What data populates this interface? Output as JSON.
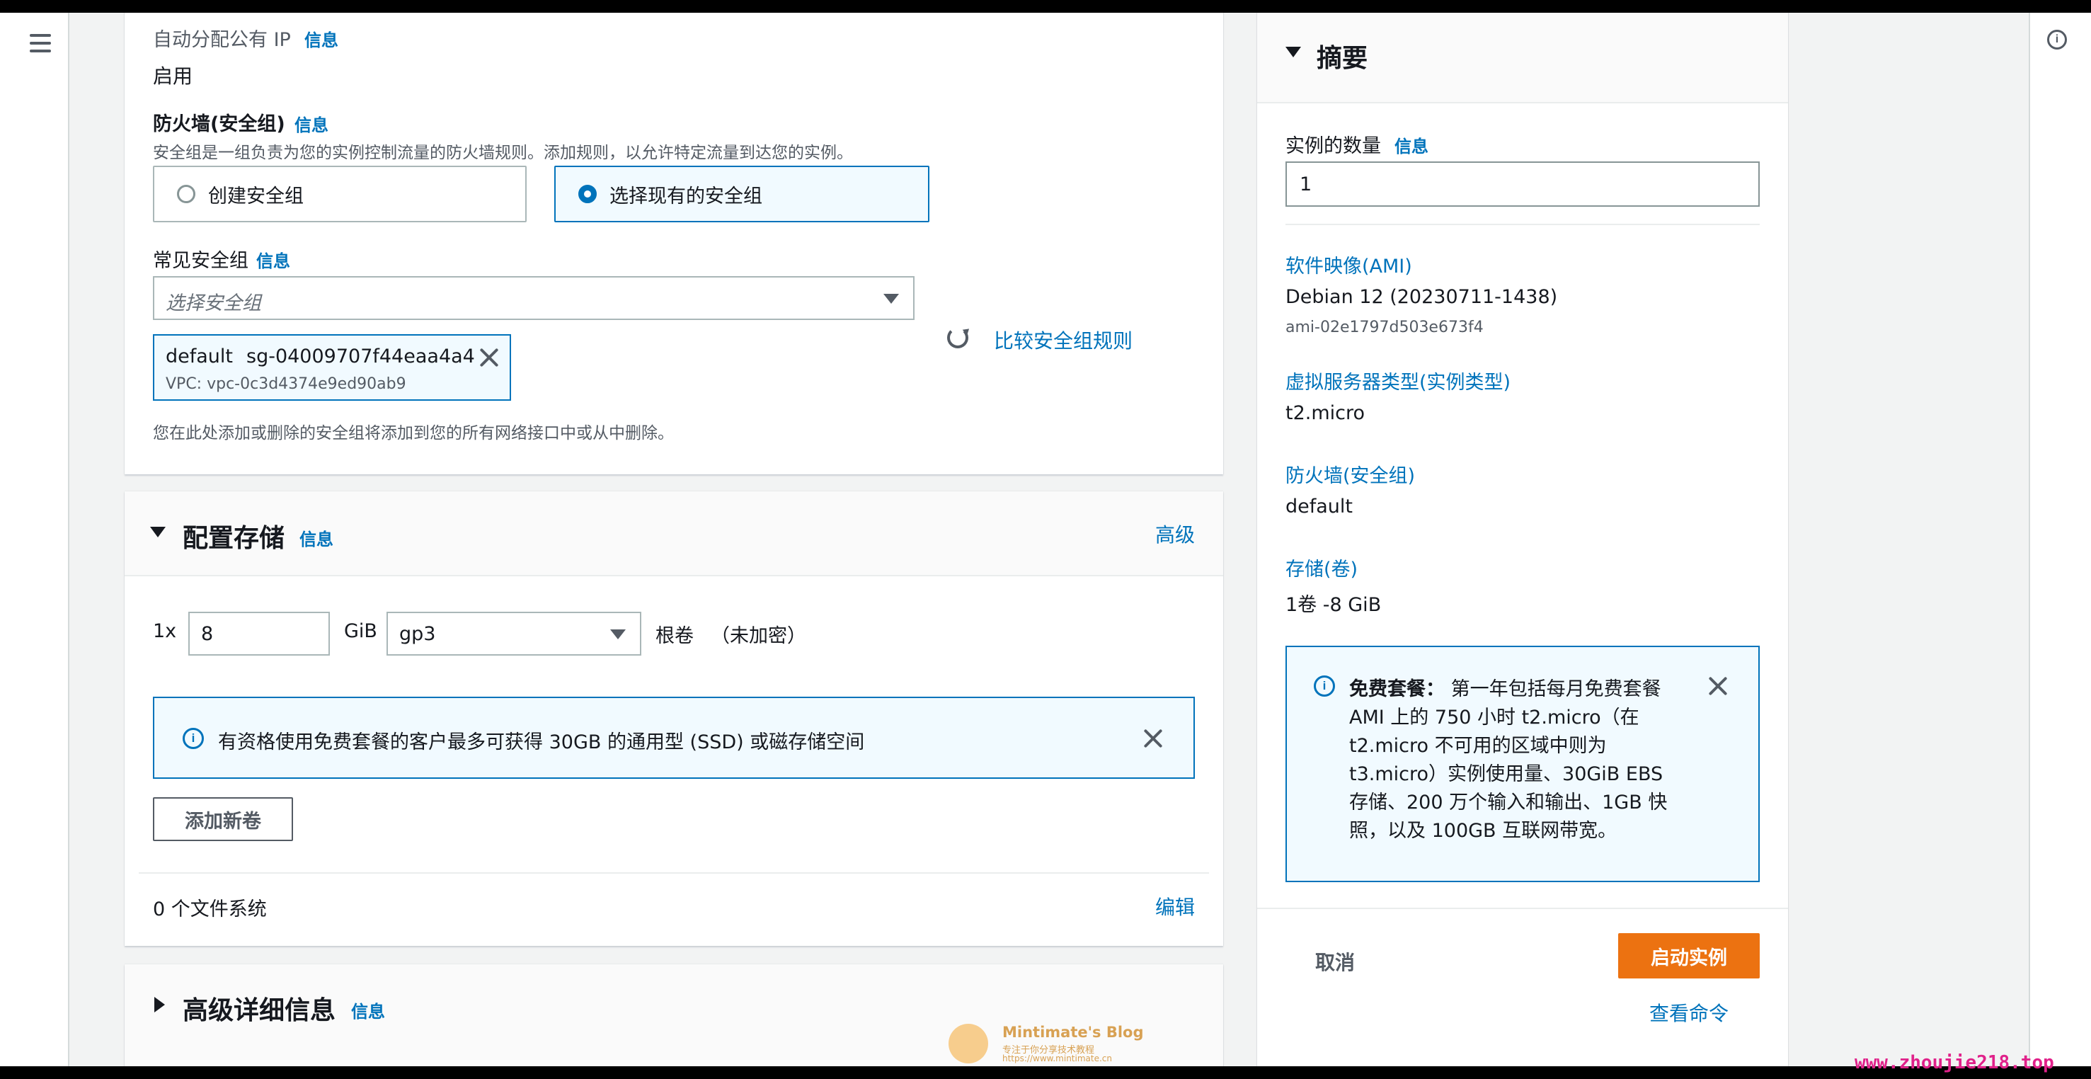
{
  "network": {
    "auto_public_ip_label": "自动分配公有 IP",
    "auto_public_ip_info": "信息",
    "auto_public_ip_value": "启用"
  },
  "firewall": {
    "title": "防火墙(安全组)",
    "info": "信息",
    "description": "安全组是一组负责为您的实例控制流量的防火墙规则。添加规则，以允许特定流量到达您的实例。",
    "option_create": "创建安全组",
    "option_select": "选择现有的安全组",
    "selected_option": "选择现有的安全组",
    "common_sg_label": "常见安全组",
    "common_sg_info": "信息",
    "select_placeholder": "选择安全组",
    "compare_rules_link": "比较安全组规则",
    "token_name": "default",
    "token_id": "sg-04009707f44eaa4a4",
    "token_vpc": "VPC: vpc-0c3d4374e9ed90ab9",
    "footnote": "您在此处添加或删除的安全组将添加到您的所有网络接口中或从中删除。"
  },
  "storage": {
    "title": "配置存储",
    "info": "信息",
    "advanced_link": "高级",
    "count_prefix": "1x",
    "size_value": "8",
    "unit": "GiB",
    "volume_type": "gp3",
    "root_label": "根卷",
    "encryption": "（未加密）",
    "free_tier_alert": "有资格使用免费套餐的客户最多可获得 30GB 的通用型 (SSD) 或磁存储空间",
    "add_volume_button": "添加新卷",
    "filesystems": "0 个文件系统",
    "edit_link": "编辑"
  },
  "advanced": {
    "title": "高级详细信息",
    "info": "信息"
  },
  "summary": {
    "title": "摘要",
    "instance_count_label": "实例的数量",
    "instance_count_info": "信息",
    "instance_count_value": "1",
    "ami_label": "软件映像(AMI)",
    "ami_name": "Debian 12 (20230711-1438)",
    "ami_id": "ami-02e1797d503e673f4",
    "instance_type_label": "虚拟服务器类型(实例类型)",
    "instance_type_value": "t2.micro",
    "firewall_label": "防火墙(安全组)",
    "firewall_value": "default",
    "storage_label": "存储(卷)",
    "storage_value": "1卷 -8 GiB",
    "free_tier_bold": "免费套餐：",
    "free_tier_line1": "第一年包括每月免费套餐",
    "free_tier_line2": "AMI 上的 750 小时 t2.micro（在",
    "free_tier_line3": "t2.micro 不可用的区域中则为",
    "free_tier_line4": "t3.micro）实例使用量、30GiB EBS",
    "free_tier_line5": "存储、200 万个输入和输出、1GB 快",
    "free_tier_line6": "照，以及 100GB 互联网带宽。",
    "cancel": "取消",
    "launch": "启动实例",
    "view_commands": "查看命令"
  },
  "watermark": {
    "blog_name": "Mintimate's Blog",
    "blog_tagline": "专注于你分享技术教程",
    "blog_url": "https://www.mintimate.cn",
    "site": "www.zhoujie218.top"
  },
  "colors": {
    "link": "#0073bb",
    "primary_button": "#ec7211",
    "alert_bg": "#f1faff",
    "watermark_site": "#e0218a"
  }
}
